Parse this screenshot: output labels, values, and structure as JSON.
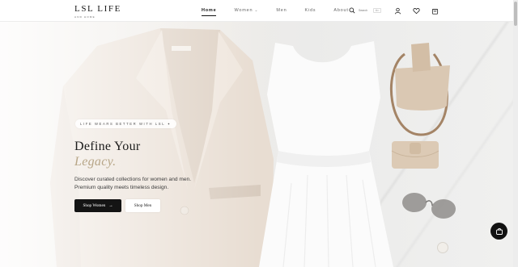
{
  "header": {
    "logo": "LSL LIFE",
    "logo_sub": "AND HOME",
    "nav": [
      {
        "label": "Home",
        "active": true
      },
      {
        "label": "Women",
        "active": false,
        "has_dropdown": true
      },
      {
        "label": "Men",
        "active": false
      },
      {
        "label": "Kids",
        "active": false
      },
      {
        "label": "About",
        "active": false
      }
    ],
    "search_placeholder": "Search",
    "search_shortcut": "⌘K",
    "icons": [
      "search-icon",
      "user-icon",
      "heart-icon",
      "bag-icon"
    ]
  },
  "hero": {
    "badge": "LIFE WEARS BETTER WITH LSL ✦",
    "headline_line1": "Define Your",
    "headline_line2": "Legacy.",
    "description": "Discover curated collections for women and men. Premium quality meets timeless design.",
    "primary_button": "Shop Women",
    "primary_button_arrow": "→",
    "secondary_button": "Shop Men"
  },
  "colors": {
    "accent_gold": "#b8a688",
    "primary_dark": "#141414"
  },
  "chat_icon": "chat-bag-icon"
}
